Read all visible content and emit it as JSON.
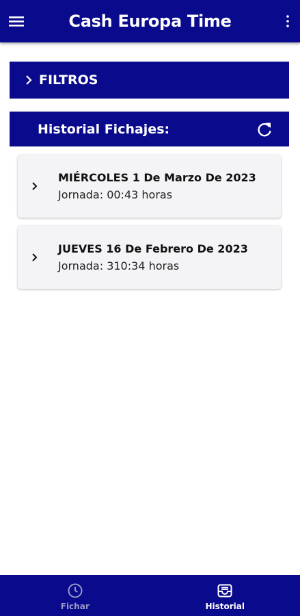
{
  "app_bar": {
    "title": "Cash Europa Time",
    "menu_icon": "hamburger-menu-icon",
    "more_icon": "more-vertical-icon"
  },
  "filters": {
    "label": "FILTROS",
    "icon": "chevron-right-icon"
  },
  "history": {
    "title": "Historial Fichajes:",
    "refresh_icon": "refresh-icon"
  },
  "entries": [
    {
      "date": "MIÉRCOLES 1 De Marzo De 2023",
      "jornada": "Jornada: 00:43 horas"
    },
    {
      "date": "JUEVES 16 De Febrero De 2023",
      "jornada": "Jornada: 310:34 horas"
    }
  ],
  "bottom_nav": [
    {
      "label": "Fichar",
      "icon": "clock-icon",
      "active": false
    },
    {
      "label": "Historial",
      "icon": "inbox-tray-icon",
      "active": true
    }
  ],
  "colors": {
    "primary": "#0a0a8c",
    "card_bg": "#f4f4f6",
    "nav_inactive": "#9999c6"
  }
}
